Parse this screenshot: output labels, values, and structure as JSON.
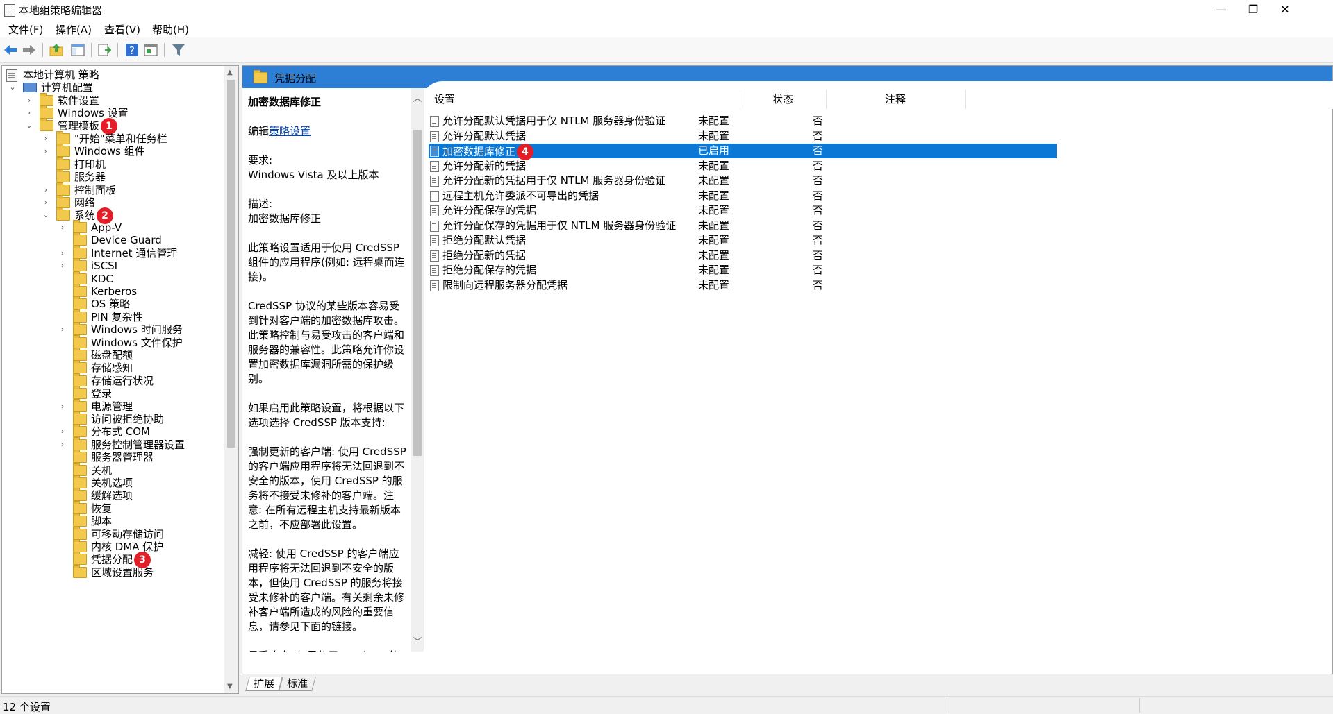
{
  "window": {
    "title": "本地组策略编辑器",
    "min": "—",
    "max": "❐",
    "close": "✕"
  },
  "menu": [
    "文件(F)",
    "操作(A)",
    "查看(V)",
    "帮助(H)"
  ],
  "tree": {
    "root": "本地计算机 策略",
    "computer": "计算机配置",
    "software": "软件设置",
    "windows_settings": "Windows 设置",
    "admin_templates": "管理模板",
    "admin_children": [
      "\"开始\"菜单和任务栏",
      "Windows 组件",
      "打印机",
      "服务器",
      "控制面板",
      "网络"
    ],
    "system": "系统",
    "system_children": [
      "App-V",
      "Device Guard",
      "Internet 通信管理",
      "iSCSI",
      "KDC",
      "Kerberos",
      "OS 策略",
      "PIN 复杂性",
      "Windows 时间服务",
      "Windows 文件保护",
      "磁盘配额",
      "存储感知",
      "存储运行状况",
      "登录",
      "电源管理",
      "访问被拒绝协助",
      "分布式 COM",
      "服务控制管理器设置",
      "服务器管理器",
      "关机",
      "关机选项",
      "缓解选项",
      "恢复",
      "脚本",
      "可移动存储访问",
      "内核 DMA 保护",
      "凭据分配",
      "区域设置服务"
    ],
    "badges": [
      "1",
      "2",
      "3",
      "4"
    ]
  },
  "pane": {
    "header": "凭据分配",
    "desc_title": "加密数据库修正",
    "edit_prefix": "编辑",
    "edit_link": "策略设置",
    "desc_body": "要求:\nWindows Vista 及以上版本\n\n描述:\n加密数据库修正\n\n此策略设置适用于使用 CredSSP 组件的应用程序(例如: 远程桌面连接)。\n\nCredSSP 协议的某些版本容易受到针对客户端的加密数据库攻击。此策略控制与易受攻击的客户端和服务器的兼容性。此策略允许你设置加密数据库漏洞所需的保护级别。\n\n如果启用此策略设置，将根据以下选项选择 CredSSP 版本支持:\n\n强制更新的客户端: 使用 CredSSP 的客户端应用程序将无法回退到不安全的版本，使用 CredSSP 的服务将不接受未修补的客户端。注意: 在所有远程主机支持最新版本之前，不应部署此设置。\n\n减轻: 使用 CredSSP 的客户端应用程序将无法回退到不安全的版本，但使用 CredSSP 的服务将接受未修补的客户端。有关剩余未修补客户端所造成的风险的重要信息，请参见下面的链接。\n\n易受攻击: 如果使用 CredSSP 的客户端应用程序支持回退到不安全的",
    "columns": [
      "设置",
      "状态",
      "注释"
    ],
    "rows": [
      {
        "name": "允许分配默认凭据用于仅 NTLM 服务器身份验证",
        "state": "未配置",
        "note": "否"
      },
      {
        "name": "允许分配默认凭据",
        "state": "未配置",
        "note": "否"
      },
      {
        "name": "加密数据库修正",
        "state": "已启用",
        "note": "否"
      },
      {
        "name": "允许分配新的凭据",
        "state": "未配置",
        "note": "否"
      },
      {
        "name": "允许分配新的凭据用于仅 NTLM 服务器身份验证",
        "state": "未配置",
        "note": "否"
      },
      {
        "name": "远程主机允许委派不可导出的凭据",
        "state": "未配置",
        "note": "否"
      },
      {
        "name": "允许分配保存的凭据",
        "state": "未配置",
        "note": "否"
      },
      {
        "name": "允许分配保存的凭据用于仅 NTLM 服务器身份验证",
        "state": "未配置",
        "note": "否"
      },
      {
        "name": "拒绝分配默认凭据",
        "state": "未配置",
        "note": "否"
      },
      {
        "name": "拒绝分配新的凭据",
        "state": "未配置",
        "note": "否"
      },
      {
        "name": "拒绝分配保存的凭据",
        "state": "未配置",
        "note": "否"
      },
      {
        "name": "限制向远程服务器分配凭据",
        "state": "未配置",
        "note": "否"
      }
    ],
    "tabs": [
      "扩展",
      "标准"
    ]
  },
  "status": "12 个设置",
  "colors": {
    "header_blue": "#2d7fd6",
    "selection": "#0b78d6",
    "badge": "#e41e26"
  }
}
